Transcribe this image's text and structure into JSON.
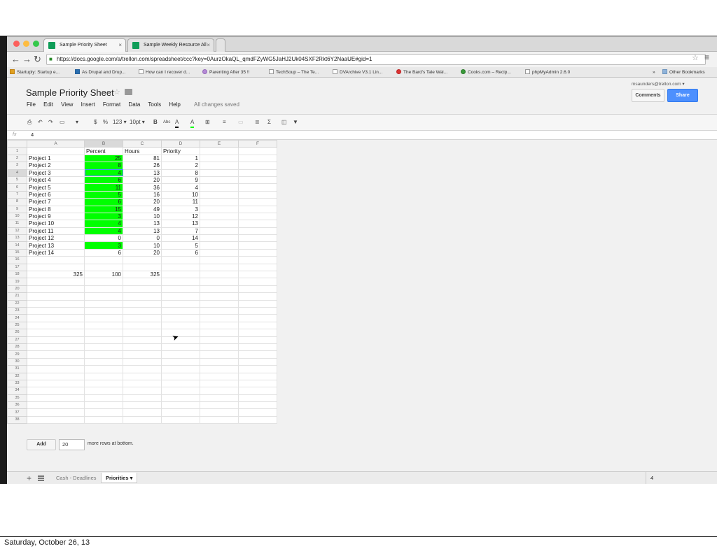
{
  "browser": {
    "tabs": [
      {
        "label": "Sample Priority Sheet",
        "close": "×"
      },
      {
        "label": "Sample Weekly Resource All",
        "close": "×"
      }
    ],
    "back": "←",
    "forward": "→",
    "reload": "↻",
    "url": "https://docs.google.com/a/trellon.com/spreadsheet/ccc?key=0AurzOkaQL_qmdFZyWG5JaHJ2Uk04SXF2Rkt6Y2NaaUE#gid=1",
    "bookmarks": [
      "Startuply: Startup e...",
      "As Drupal and Drup...",
      "How can I recover d...",
      "Parenting After 35 !!",
      "TechSoup – The Te...",
      "DVArchive V3.1 Lin...",
      "The Bard's Tale Wal...",
      "Cooks.com – Recip...",
      "phpMyAdmin 2.6.0"
    ],
    "other_bookmarks": "Other Bookmarks",
    "more": "»"
  },
  "doc": {
    "title": "Sample Priority Sheet",
    "user": "msaunders@trellon.com ▾",
    "comments_label": "Comments",
    "share_label": "Share",
    "menus": [
      "File",
      "Edit",
      "View",
      "Insert",
      "Format",
      "Data",
      "Tools",
      "Help"
    ],
    "save_status": "All changes saved"
  },
  "toolbar": {
    "currency": "$",
    "percent": "%",
    "number_format": "123 ▾",
    "font_size": "10pt ▾",
    "bold": "B",
    "strike": "Abc",
    "text_color": "A",
    "fill_color": "A",
    "sum": "Σ"
  },
  "formula": {
    "label": "fx",
    "value": "4"
  },
  "grid": {
    "columns": [
      "A",
      "B",
      "C",
      "D",
      "E",
      "F"
    ],
    "selected_column": "B",
    "selected_row": 4,
    "rows": [
      {
        "n": "1",
        "a": "",
        "b": "Percent",
        "c": "Hours",
        "d": "Priority"
      },
      {
        "n": "2",
        "a": "Project 1",
        "b": "25",
        "c": "81",
        "d": "1",
        "green": true
      },
      {
        "n": "3",
        "a": "Project 2",
        "b": "8",
        "c": "26",
        "d": "2",
        "green": true
      },
      {
        "n": "4",
        "a": "Project 3",
        "b": "4",
        "c": "13",
        "d": "8",
        "green": true
      },
      {
        "n": "5",
        "a": "Project 4",
        "b": "6",
        "c": "20",
        "d": "9",
        "green": true
      },
      {
        "n": "6",
        "a": "Project 5",
        "b": "11",
        "c": "36",
        "d": "4",
        "green": true
      },
      {
        "n": "7",
        "a": "Project 6",
        "b": "5",
        "c": "16",
        "d": "10",
        "green": true
      },
      {
        "n": "8",
        "a": "Project 7",
        "b": "6",
        "c": "20",
        "d": "11",
        "green": true
      },
      {
        "n": "9",
        "a": "Project 8",
        "b": "15",
        "c": "49",
        "d": "3",
        "green": true
      },
      {
        "n": "10",
        "a": "Project 9",
        "b": "3",
        "c": "10",
        "d": "12",
        "green": true
      },
      {
        "n": "11",
        "a": "Project 10",
        "b": "4",
        "c": "13",
        "d": "13",
        "green": true
      },
      {
        "n": "12",
        "a": "Project 11",
        "b": "4",
        "c": "13",
        "d": "7",
        "green": true
      },
      {
        "n": "13",
        "a": "Project 12",
        "b": "0",
        "c": "0",
        "d": "14"
      },
      {
        "n": "14",
        "a": "Project 13",
        "b": "3",
        "c": "10",
        "d": "5",
        "green": true
      },
      {
        "n": "15",
        "a": "Project 14",
        "b": "6",
        "c": "20",
        "d": "6"
      },
      {
        "n": "16"
      },
      {
        "n": "17"
      },
      {
        "n": "18",
        "a": "325",
        "b": "100",
        "c": "325",
        "d": ""
      },
      {
        "n": "19"
      },
      {
        "n": "20"
      },
      {
        "n": "21"
      },
      {
        "n": "22"
      },
      {
        "n": "23"
      },
      {
        "n": "24"
      },
      {
        "n": "25"
      },
      {
        "n": "26"
      },
      {
        "n": "27"
      },
      {
        "n": "28"
      },
      {
        "n": "29"
      },
      {
        "n": "30"
      },
      {
        "n": "31"
      },
      {
        "n": "32"
      },
      {
        "n": "33"
      },
      {
        "n": "34"
      },
      {
        "n": "35"
      },
      {
        "n": "36"
      },
      {
        "n": "37"
      },
      {
        "n": "38"
      }
    ],
    "green_color": "#00ff00"
  },
  "add_rows": {
    "button": "Add",
    "value": "20",
    "text": "more rows at bottom."
  },
  "sheets": {
    "tabs": [
      {
        "label": "Cash - Deadlines",
        "active": false
      },
      {
        "label": "Priorities ▾",
        "active": true
      }
    ],
    "add": "+",
    "summary": "4"
  },
  "caption": "Saturday, October 26, 13"
}
